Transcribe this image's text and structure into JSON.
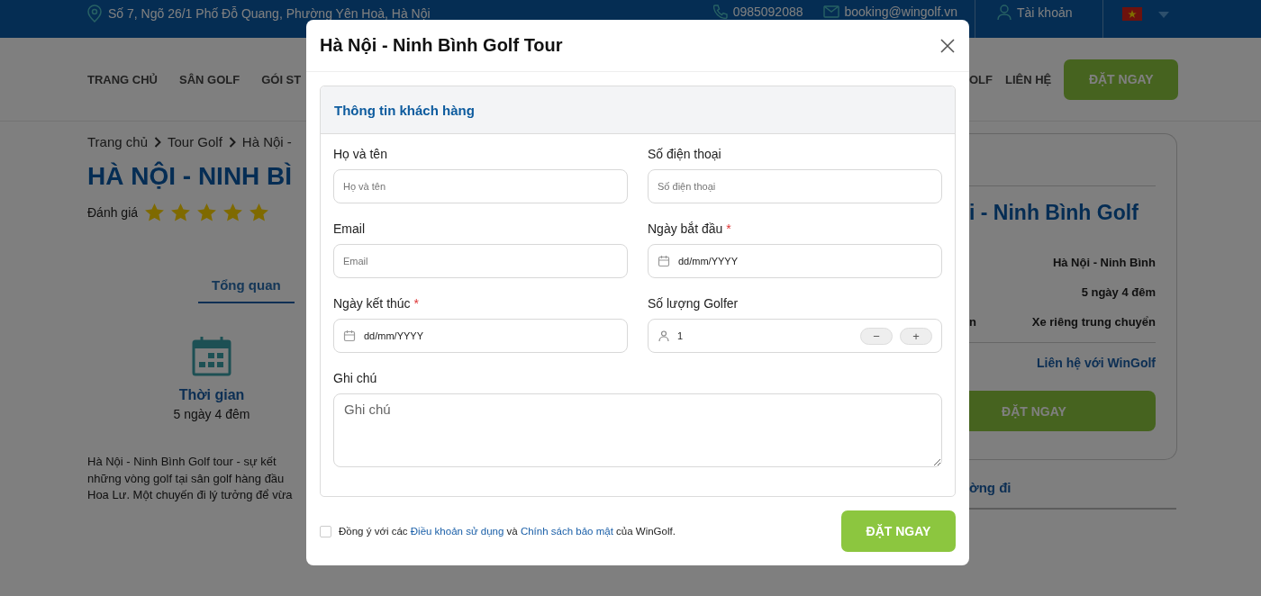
{
  "topbar": {
    "address": "Số 7, Ngõ 26/1 Phố Đỗ Quang, Phường Yên Hoà, Hà Nội",
    "phone": "0985092088",
    "email": "booking@wingolf.vn",
    "account": "Tài khoản"
  },
  "nav": {
    "left": [
      "TRANG CHỦ",
      "SÂN GOLF",
      "GÓI ST"
    ],
    "right": [
      "OLF",
      "LIÊN HỆ"
    ],
    "button": "ĐẶT NGAY"
  },
  "breadcrumbs": [
    "Trang chủ",
    "Tour Golf",
    "Hà Nội -"
  ],
  "page_title": "HÀ NỘI - NINH BÌ",
  "rating": {
    "label": "Đánh giá",
    "stars": 5
  },
  "tabs": [
    {
      "label": "Tổng quan",
      "selected": true
    }
  ],
  "overview": {
    "title": "Thời gian",
    "value": "5 ngày 4 đêm"
  },
  "description": "Hà Nội - Ninh Bình Golf tour - sự kết\nnhững vòng golf tại sân golf hàng đầu\nHoa Lư. Một chuyến đi lý tưởng để vừa",
  "summary_card": {
    "title": "i - Ninh Bình Golf",
    "rows": [
      {
        "value": "Hà Nội - Ninh Bình"
      },
      {
        "value": "5 ngày 4 đêm"
      },
      {
        "label": "n",
        "value": "Xe riêng trung chuyển"
      }
    ],
    "contact": "Liên hệ với WinGolf",
    "button": "ĐẶT NGAY"
  },
  "route_tab": "ờng đi",
  "modal": {
    "title": "Hà Nội - Ninh Bình Golf Tour",
    "section_title": "Thông tin khách hàng",
    "fields": [
      {
        "kind": "text",
        "label": "Họ và tên",
        "required": false,
        "placeholder": "Họ và tên"
      },
      {
        "kind": "text",
        "label": "Số điện thoại",
        "required": false,
        "placeholder": "Số điện thoại"
      },
      {
        "kind": "text",
        "label": "Email",
        "required": false,
        "placeholder": "Email"
      },
      {
        "kind": "date",
        "label": "Ngày bắt đầu",
        "required": true,
        "placeholder": "dd/mm/YYYY"
      },
      {
        "kind": "date",
        "label": "Ngày kết thúc",
        "required": true,
        "placeholder": "dd/mm/YYYY"
      },
      {
        "kind": "stepper",
        "label": "Số lượng Golfer",
        "required": false,
        "value": "1",
        "minus": "−",
        "plus": "+"
      },
      {
        "kind": "textarea",
        "label": "Ghi chú",
        "required": false,
        "placeholder": "Ghi chú"
      }
    ],
    "required_mark": "*",
    "consent": {
      "checked": false,
      "parts": [
        {
          "text": "Đồng ý với các ",
          "link": false
        },
        {
          "text": "Điều khoản sử dụng",
          "link": true
        },
        {
          "text": " và ",
          "link": false
        },
        {
          "text": "Chính sách bảo mật",
          "link": true
        },
        {
          "text": " của WinGolf.",
          "link": false
        }
      ]
    },
    "submit": "ĐẶT NGAY"
  }
}
